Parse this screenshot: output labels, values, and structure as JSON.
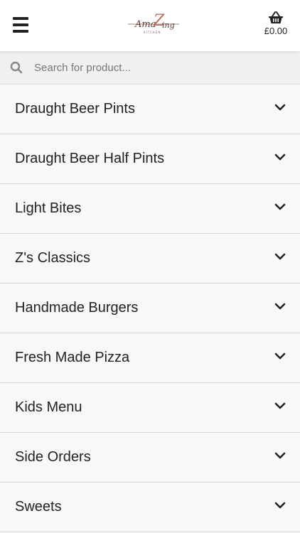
{
  "header": {
    "logo_alt": "AmaZing Kitchen",
    "cart_total": "£0.00"
  },
  "search": {
    "placeholder": "Search for product..."
  },
  "categories": [
    {
      "label": "Draught Beer Pints"
    },
    {
      "label": "Draught Beer Half Pints"
    },
    {
      "label": "Light Bites"
    },
    {
      "label": "Z's Classics"
    },
    {
      "label": "Handmade Burgers"
    },
    {
      "label": "Fresh Made Pizza"
    },
    {
      "label": "Kids Menu"
    },
    {
      "label": "Side Orders"
    },
    {
      "label": "Sweets"
    }
  ],
  "colors": {
    "logo_accent": "#b07060",
    "text": "#222222",
    "row_background": "#f8f8f8"
  }
}
